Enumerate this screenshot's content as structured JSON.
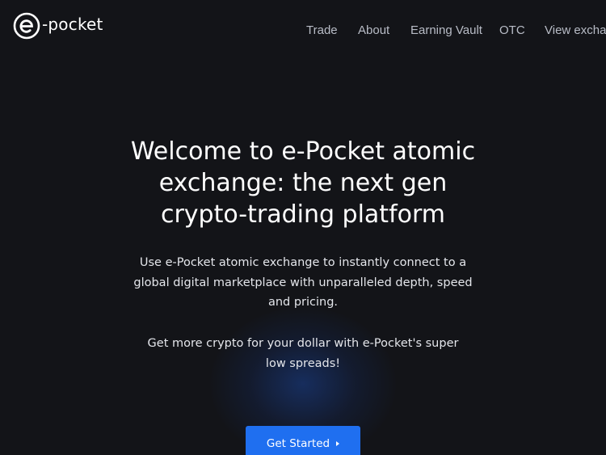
{
  "brand": {
    "name": "e-pocket",
    "logo_letter": "e",
    "logo_suffix": "-pocket"
  },
  "nav": {
    "items": [
      {
        "label": "Trade"
      },
      {
        "label": "About"
      },
      {
        "label": "Earning Vault"
      },
      {
        "label": "OTC"
      },
      {
        "label": "View exchan"
      }
    ]
  },
  "hero": {
    "title_lines": [
      "Welcome to e-Pocket atomic",
      "exchange: the next gen",
      "crypto-trading platform"
    ],
    "description_lines": [
      "Use e-Pocket atomic exchange to instantly connect to a",
      "global digital marketplace with unparalleled depth, speed",
      "and pricing."
    ],
    "tagline_lines": [
      "Get more crypto for your dollar with e-Pocket's super",
      "low spreads!"
    ],
    "cta_label": "Get Started",
    "cta_icon": "caret-right-icon"
  },
  "colors": {
    "background": "#131418",
    "nav_text": "#b8bcc6",
    "accent": "#1f6ff0",
    "glow": "#1a4296"
  }
}
